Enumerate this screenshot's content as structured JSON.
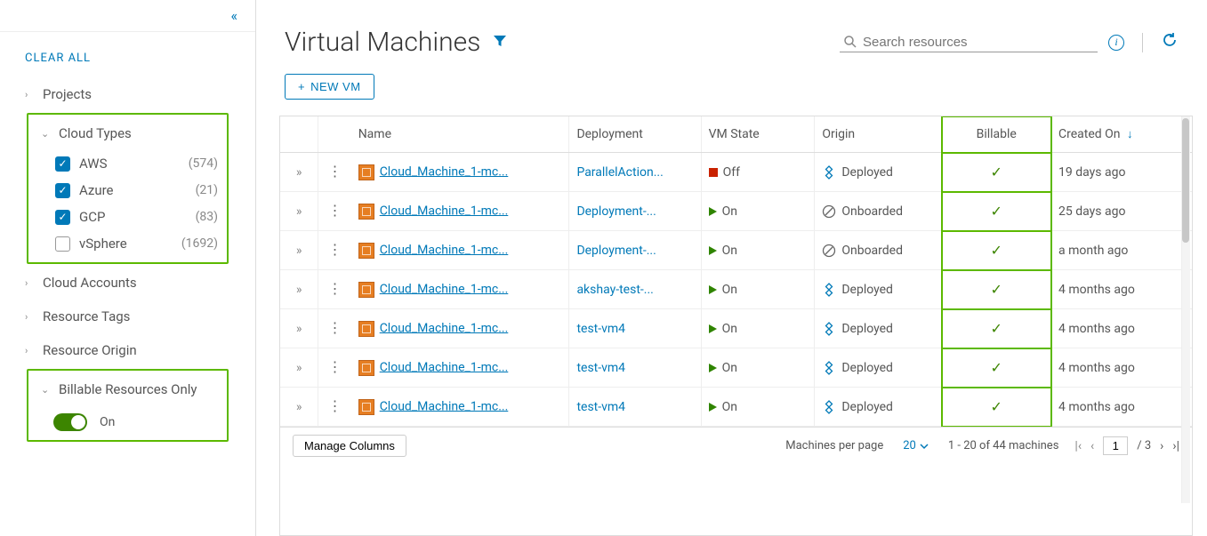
{
  "sidebar": {
    "clear_all": "CLEAR ALL",
    "groups": [
      {
        "label": "Projects",
        "expanded": false
      },
      {
        "label": "Cloud Types",
        "expanded": true,
        "highlight": true,
        "items": [
          {
            "label": "AWS",
            "count": "(574)",
            "checked": true
          },
          {
            "label": "Azure",
            "count": "(21)",
            "checked": true
          },
          {
            "label": "GCP",
            "count": "(83)",
            "checked": true
          },
          {
            "label": "vSphere",
            "count": "(1692)",
            "checked": false
          }
        ]
      },
      {
        "label": "Cloud Accounts",
        "expanded": false
      },
      {
        "label": "Resource Tags",
        "expanded": false
      },
      {
        "label": "Resource Origin",
        "expanded": false
      },
      {
        "label": "Billable Resources Only",
        "expanded": true,
        "highlight": true,
        "toggle": {
          "on": true,
          "label": "On"
        }
      }
    ]
  },
  "header": {
    "title": "Virtual Machines",
    "search_placeholder": "Search resources",
    "new_vm": "NEW VM"
  },
  "table": {
    "columns": {
      "name": "Name",
      "deployment": "Deployment",
      "state": "VM State",
      "origin": "Origin",
      "billable": "Billable",
      "created": "Created On"
    },
    "rows": [
      {
        "name": "Cloud_Machine_1-mc...",
        "deployment": "ParallelAction...",
        "state": "Off",
        "origin": "Deployed",
        "origin_icon": "deployed",
        "billable": true,
        "created": "19 days ago"
      },
      {
        "name": "Cloud_Machine_1-mc...",
        "deployment": "Deployment-...",
        "state": "On",
        "origin": "Onboarded",
        "origin_icon": "onboarded",
        "billable": true,
        "created": "25 days ago"
      },
      {
        "name": "Cloud_Machine_1-mc...",
        "deployment": "Deployment-...",
        "state": "On",
        "origin": "Onboarded",
        "origin_icon": "onboarded",
        "billable": true,
        "created": "a month ago"
      },
      {
        "name": "Cloud_Machine_1-mc...",
        "deployment": "akshay-test-...",
        "state": "On",
        "origin": "Deployed",
        "origin_icon": "deployed",
        "billable": true,
        "created": "4 months ago"
      },
      {
        "name": "Cloud_Machine_1-mc...",
        "deployment": "test-vm4",
        "state": "On",
        "origin": "Deployed",
        "origin_icon": "deployed",
        "billable": true,
        "created": "4 months ago"
      },
      {
        "name": "Cloud_Machine_1-mc...",
        "deployment": "test-vm4",
        "state": "On",
        "origin": "Deployed",
        "origin_icon": "deployed",
        "billable": true,
        "created": "4 months ago"
      },
      {
        "name": "Cloud_Machine_1-mc...",
        "deployment": "test-vm4",
        "state": "On",
        "origin": "Deployed",
        "origin_icon": "deployed",
        "billable": true,
        "created": "4 months ago"
      }
    ]
  },
  "footer": {
    "manage_cols": "Manage Columns",
    "per_page_label": "Machines per page",
    "per_page_value": "20",
    "range": "1 - 20 of 44 machines",
    "page_current": "1",
    "page_total": "/ 3"
  }
}
